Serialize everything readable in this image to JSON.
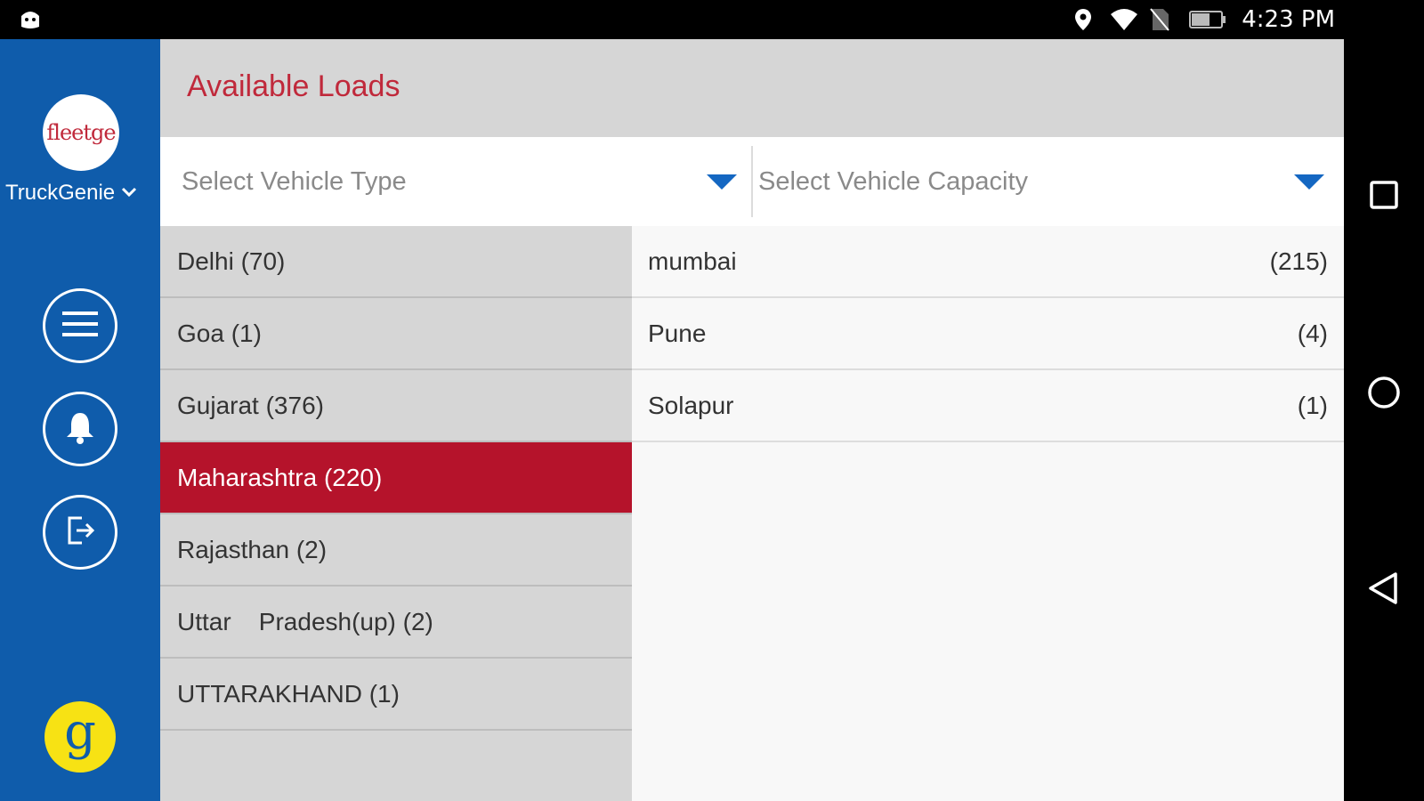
{
  "status_bar": {
    "time": "4:23 PM",
    "battery_level": "57",
    "icons": [
      "android-debug-icon",
      "location-icon",
      "wifi-icon",
      "no-sim-icon",
      "battery-icon"
    ]
  },
  "sidebar": {
    "logo_text": "fleetge",
    "brand_name": "TruckGenie",
    "buttons": [
      "menu-icon",
      "bell-icon",
      "logout-icon"
    ],
    "bottom_logo_letter": "g"
  },
  "header": {
    "title": "Available Loads"
  },
  "filters": {
    "vehicle_type_placeholder": "Select Vehicle Type",
    "vehicle_capacity_placeholder": "Select Vehicle Capacity"
  },
  "states": [
    {
      "label": "Delhi (70)"
    },
    {
      "label": "Goa (1)"
    },
    {
      "label": "Gujarat (376)"
    },
    {
      "label": "Maharashtra (220)"
    },
    {
      "label": "Rajasthan (2)"
    },
    {
      "label": "Uttar    Pradesh(up) (2)"
    },
    {
      "label": "UTTARAKHAND (1)"
    }
  ],
  "selected_state": "Maharashtra (220)",
  "cities": [
    {
      "name": "mumbai",
      "count": "(215)"
    },
    {
      "name": "Pune",
      "count": "(4)"
    },
    {
      "name": "Solapur",
      "count": "(1)"
    }
  ],
  "colors": {
    "sidebar": "#0F5CAB",
    "accent_red": "#B5132B",
    "title_red": "#C0293B",
    "caret_blue": "#1467C2",
    "yellow": "#F7E214"
  }
}
